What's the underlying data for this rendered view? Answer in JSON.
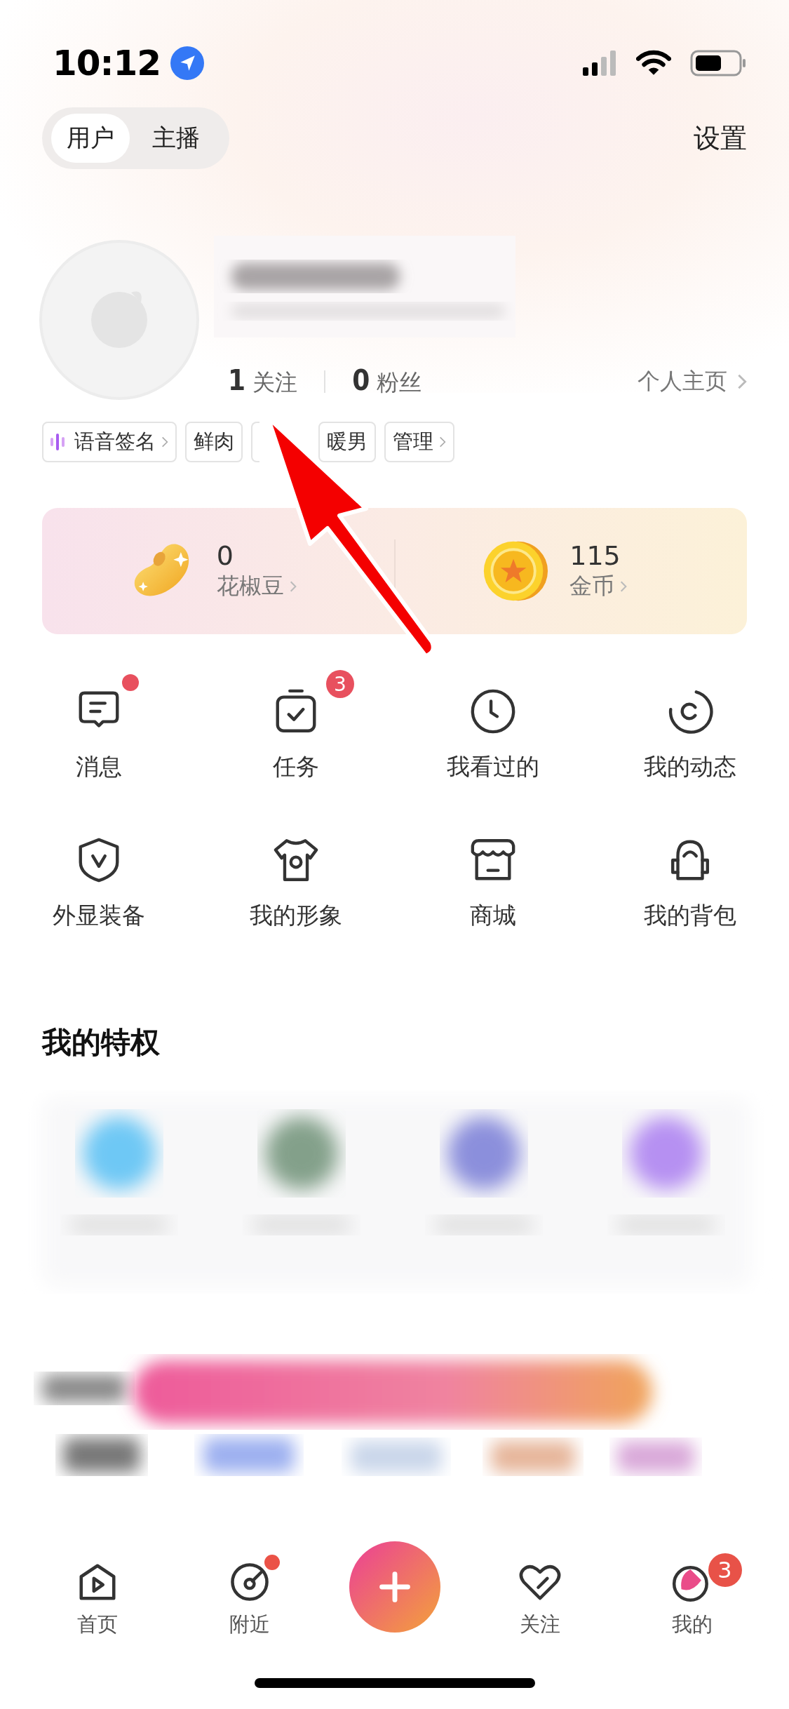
{
  "status_bar": {
    "time": "10:12"
  },
  "mode_tabs": [
    {
      "label": "用户",
      "selected": true
    },
    {
      "label": "主播",
      "selected": false
    }
  ],
  "settings": "设置",
  "profile": {
    "stats": [
      {
        "count": "1",
        "label": "关注"
      },
      {
        "count": "0",
        "label": "粉丝"
      }
    ],
    "homepage_link": "个人主页"
  },
  "tags": [
    {
      "kind": "voice",
      "label": "语音签名"
    },
    {
      "kind": "plain",
      "label": "鲜肉"
    },
    {
      "kind": "covered"
    },
    {
      "kind": "plain",
      "label": "暖男"
    },
    {
      "kind": "link",
      "label": "管理"
    }
  ],
  "wallet": [
    {
      "kind": "bean",
      "amount": "0",
      "label": "花椒豆"
    },
    {
      "kind": "coin",
      "amount": "115",
      "label": "金币"
    }
  ],
  "menu": [
    {
      "label": "消息",
      "dot": true
    },
    {
      "label": "任务",
      "badge": "3"
    },
    {
      "label": "我看过的",
      "dot": false
    },
    {
      "label": "我的动态",
      "dot": false
    },
    {
      "label": "外显装备",
      "dot": false
    },
    {
      "label": "我的形象",
      "dot": false
    },
    {
      "label": "商城",
      "dot": false
    },
    {
      "label": "我的背包",
      "dot": false
    }
  ],
  "privileges": {
    "title": "我的特权"
  },
  "tab_bar": [
    {
      "kind": "tab",
      "label": "首页",
      "dot": false
    },
    {
      "kind": "tab",
      "label": "附近",
      "dot": true
    },
    {
      "kind": "create"
    },
    {
      "kind": "tab",
      "label": "关注",
      "dot": false
    },
    {
      "kind": "tab",
      "label": "我的",
      "badge": "3"
    }
  ]
}
